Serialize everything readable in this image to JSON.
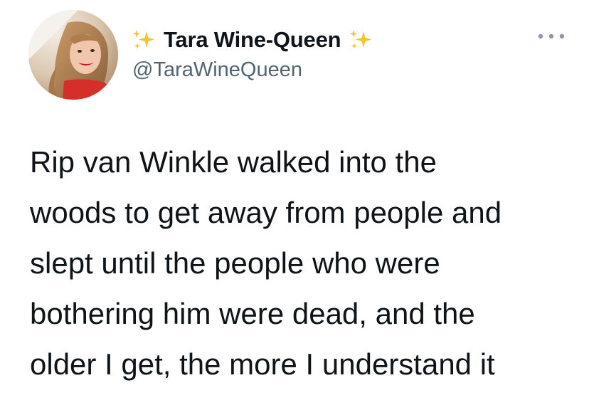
{
  "tweet": {
    "author": {
      "display_name": "Tara Wine-Queen",
      "handle": "@TaraWineQueen",
      "avatar_icon": "profile-photo",
      "name_prefix_icon": "sparkles-emoji",
      "name_suffix_icon": "sparkles-emoji"
    },
    "more_icon": "more-options-icon",
    "text_lines": [
      "Rip van Winkle walked into the",
      "woods to get away from people and",
      "slept until the people who were",
      "bothering him were dead, and the",
      "older I get, the more I understand it"
    ],
    "colors": {
      "name": "#0f1419",
      "handle": "#536471",
      "body_text": "#0f1419",
      "sparkle": "#f4c430",
      "more_dots": "#8b98a5"
    }
  }
}
